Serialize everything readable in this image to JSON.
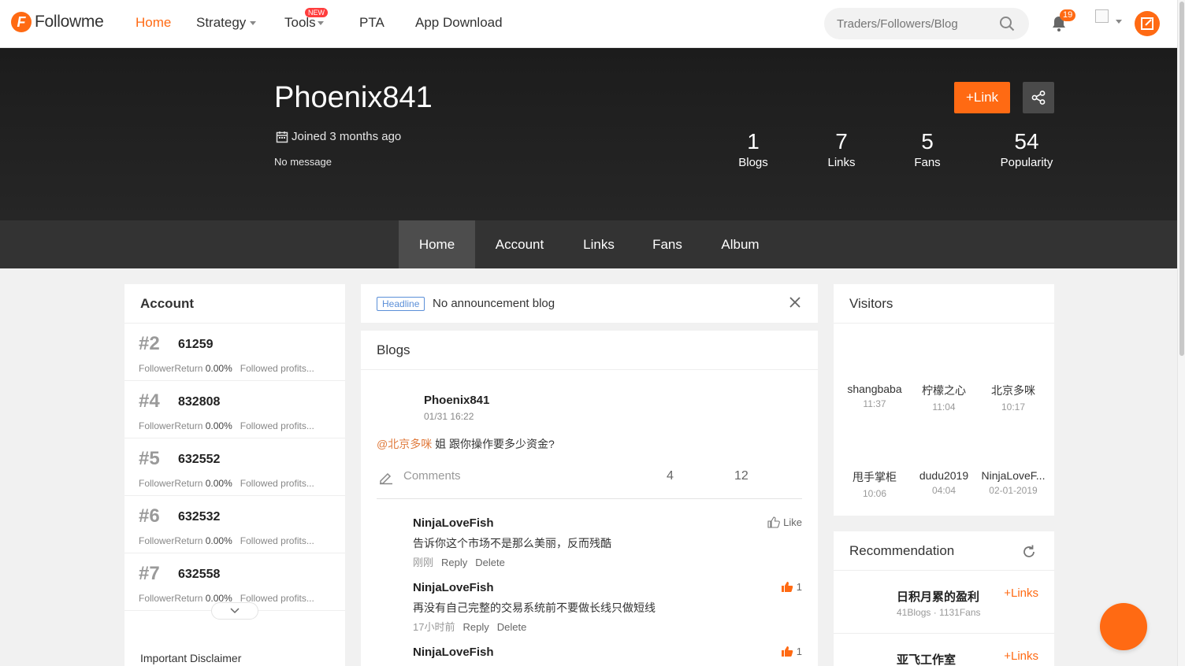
{
  "brand": {
    "name": "Followme",
    "accent": "#ff6a13"
  },
  "nav": {
    "home": "Home",
    "strategy": "Strategy",
    "tools": "Tools",
    "tools_badge": "NEW",
    "pta": "PTA",
    "app_download": "App Download"
  },
  "search": {
    "placeholder": "Traders/Followers/Blog"
  },
  "notifications": {
    "count": "19"
  },
  "profile": {
    "username": "Phoenix841",
    "joined": "Joined 3 months ago",
    "message": "No message",
    "link_button": "+Link",
    "stats": [
      {
        "value": "1",
        "label": "Blogs"
      },
      {
        "value": "7",
        "label": "Links"
      },
      {
        "value": "5",
        "label": "Fans"
      },
      {
        "value": "54",
        "label": "Popularity"
      }
    ]
  },
  "tabs": [
    "Home",
    "Account",
    "Links",
    "Fans",
    "Album"
  ],
  "account_panel": {
    "title": "Account",
    "items": [
      {
        "rank": "#2",
        "id": "61259",
        "follower": "Follower",
        "return_label": "Return",
        "return_value": "0.00%",
        "followed": "Followed profits..."
      },
      {
        "rank": "#4",
        "id": "832808",
        "follower": "Follower",
        "return_label": "Return",
        "return_value": "0.00%",
        "followed": "Followed profits..."
      },
      {
        "rank": "#5",
        "id": "632552",
        "follower": "Follower",
        "return_label": "Return",
        "return_value": "0.00%",
        "followed": "Followed profits..."
      },
      {
        "rank": "#6",
        "id": "632532",
        "follower": "Follower",
        "return_label": "Return",
        "return_value": "0.00%",
        "followed": "Followed profits..."
      },
      {
        "rank": "#7",
        "id": "632558",
        "follower": "Follower",
        "return_label": "Return",
        "return_value": "0.00%",
        "followed": "Followed profits..."
      }
    ],
    "disclaimer": "Important Disclaimer"
  },
  "headline": {
    "tag": "Headline",
    "text": "No announcement blog"
  },
  "blogs": {
    "title": "Blogs",
    "post": {
      "author": "Phoenix841",
      "time": "01/31 16:22",
      "mention": "@北京多咪",
      "body": " 姐 跟你操作要多少资金?",
      "comments_label": "Comments",
      "count_a": "4",
      "count_b": "12"
    },
    "comments": [
      {
        "name": "NinjaLoveFish",
        "text": "告诉你这个市场不是那么美丽，反而残酷",
        "time": "刚刚",
        "reply": "Reply",
        "delete": "Delete",
        "like": "Like"
      },
      {
        "name": "NinjaLoveFish",
        "text": "再没有自己完整的交易系统前不要做长线只做短线",
        "time": "17小时前",
        "reply": "Reply",
        "delete": "Delete",
        "like": "1"
      },
      {
        "name": "NinjaLoveFish",
        "like": "1"
      }
    ]
  },
  "visitors": {
    "title": "Visitors",
    "items": [
      {
        "name": "shangbaba",
        "time": "11:37"
      },
      {
        "name": "柠檬之心",
        "time": "11:04"
      },
      {
        "name": "北京多咪",
        "time": "10:17"
      },
      {
        "name": "甩手掌柜",
        "time": "10:06"
      },
      {
        "name": "dudu2019",
        "time": "04:04"
      },
      {
        "name": "NinjaLoveF...",
        "time": "02-01-2019"
      }
    ]
  },
  "recommendation": {
    "title": "Recommendation",
    "items": [
      {
        "name": "日积月累的盈利",
        "meta": "41Blogs · 1131Fans",
        "link": "+Links"
      },
      {
        "name": "亚飞工作室",
        "link": "+Links"
      }
    ]
  }
}
